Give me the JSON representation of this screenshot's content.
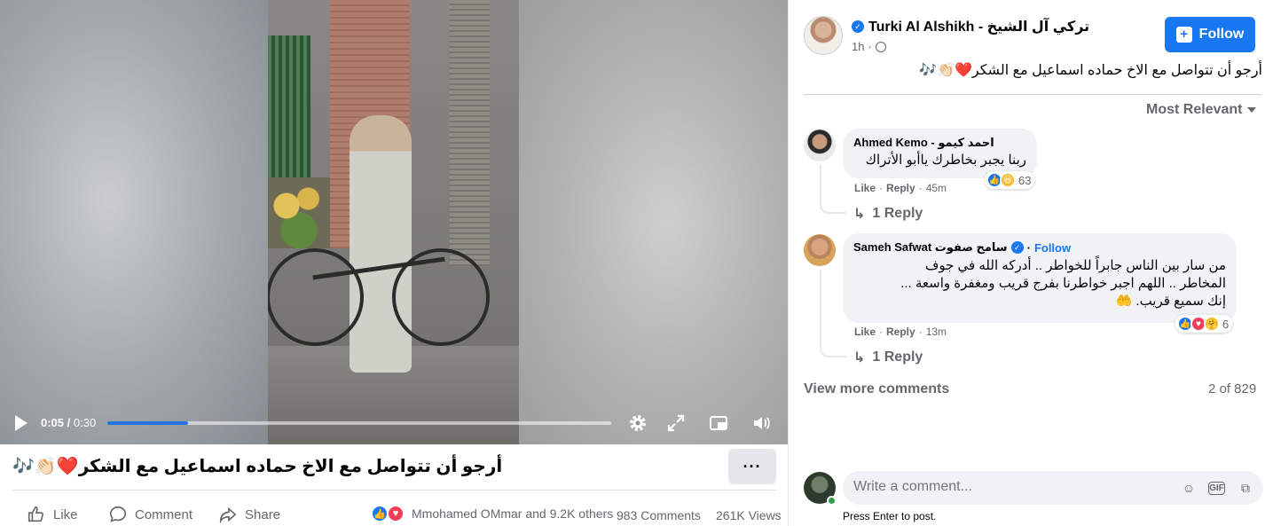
{
  "video": {
    "current_time": "0:05",
    "duration": "0:30",
    "progress": 0.16,
    "controls": {
      "play": "play-icon",
      "settings": "gear-icon",
      "fullscreen": "expand-icon",
      "pip": "picture-in-picture-icon",
      "volume": "volume-icon"
    }
  },
  "post": {
    "caption": "أرجو أن تتواصل مع الاخ حماده اسماعيل مع الشكر❤️👏🏻🎶",
    "more_label": "···",
    "actions": {
      "like": "Like",
      "comment": "Comment",
      "share": "Share"
    },
    "reactions_summary": "Mmohamed OMmar and 9.2K others",
    "comments_count": "983 Comments",
    "views_count": "261K Views"
  },
  "author": {
    "name": "Turki Al Alshikh - تركي آل الشيخ",
    "time": "1h",
    "follow_label": "Follow",
    "text": "أرجو أن تتواصل مع الاخ حماده اسماعيل مع الشكر❤️👏🏻🎶"
  },
  "comments": {
    "sort_label": "Most Relevant",
    "items": [
      {
        "name": "Ahmed Kemo - احمد كيمو",
        "text": "ربنا يجبر بخاطرك ياأبو الأتراك",
        "like": "Like",
        "reply": "Reply",
        "time": "45m",
        "reaction_count": "63",
        "replies_label": "1 Reply"
      },
      {
        "name": "Sameh Safwat سامح صفوت",
        "follow": "Follow",
        "text_lines": [
          "من سار بين الناس جابراً للخواطر .. أدركه الله في جوف",
          "المخاطر .. اللهم اجبر خواطرنا بفرج قريب ومغفرة واسعة ...",
          "إنك سميع قريب. 🤲"
        ],
        "like": "Like",
        "reply": "Reply",
        "time": "13m",
        "reaction_count": "6",
        "replies_label": "1 Reply"
      }
    ],
    "view_more": "View more comments",
    "count": "2 of 829",
    "input_placeholder": "Write a comment...",
    "hint": "Press Enter to post."
  },
  "colors": {
    "accent": "#1877f2",
    "progress": "#2374e1",
    "muted": "#65676b",
    "bubble": "#f0f2f5"
  }
}
